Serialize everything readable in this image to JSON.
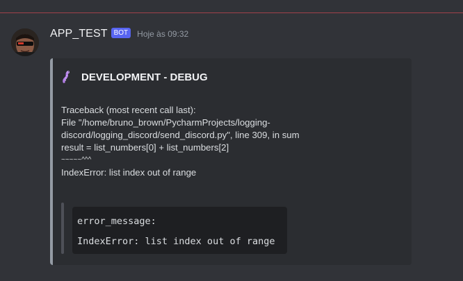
{
  "message": {
    "username": "APP_TEST",
    "badge": "BOT",
    "timestamp": "Hoje às 09:32"
  },
  "embed": {
    "icon": "worm-icon",
    "title": "DEVELOPMENT - DEBUG",
    "description_lines": [
      "Traceback (most recent call last):",
      "File \"/home/bruno_brown/PycharmProjects/logging-",
      "discord/logging_discord/send_discord.py\", line 309, in sum",
      "result = list_numbers[0] + list_numbers[2]",
      "~~~~~^^^",
      "IndexError: list index out of range"
    ],
    "field": {
      "name": "error_message:",
      "value": "IndexError: list index out of range"
    }
  },
  "colors": {
    "background": "#313338",
    "embed_background": "#2b2d31",
    "bot_badge": "#5865f2",
    "divider": "#a1414a"
  }
}
